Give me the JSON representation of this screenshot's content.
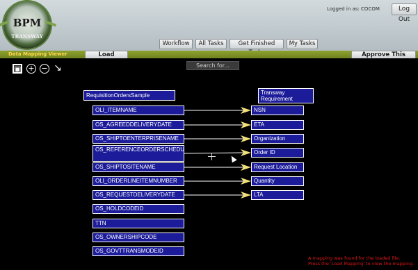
{
  "header": {
    "logo_text": "BPM",
    "logo_ring_text": "TRANSWAY",
    "logged_in": "Logged in as: COCOM",
    "logout_label": "Log Out",
    "tabs": [
      "Workflow",
      "All Tasks",
      "Get Finished Tasks",
      "My Tasks"
    ]
  },
  "toolbar": {
    "viewer_label": "Data Mapping Viewer",
    "load_label": "Load Mapping",
    "approve_label": "Approve This Mapping"
  },
  "canvas": {
    "search_label": "Search for...",
    "tools": [
      "fit-icon",
      "zoom-in-icon",
      "zoom-out-icon",
      "expand-icon"
    ],
    "source_title": "RequisitionOrdersSample",
    "target_title": "Transway Requirement",
    "source_fields": [
      "OLI_ITEMNAME",
      "OS_AGREEDDELIVERYDATE",
      "OS_SHIPTOENTERPRISENAME",
      "OS_REFERENCEORDERSCHEDULENUM",
      "OS_SHIPTOSITENAME",
      "OLI_ORDERLINEITEMNUMBER",
      "OS_REQUESTDELIVERYDATE",
      "OS_HOLDCODEID",
      "TTN",
      "OS_OWNERSHIPCODE",
      "OS_GOVTTRANSMODEID"
    ],
    "target_fields": [
      "NSN",
      "ETA",
      "Organization",
      "Order ID",
      "Request Location",
      "Quantity",
      "LTA"
    ],
    "message_line1": "A mapping was found for the loaded file.",
    "message_line2": "Press the 'Load Mapping' to view the mapping."
  },
  "colors": {
    "node_fill": "#1c1c9a",
    "arrow_head": "#f2e07a",
    "accent_bar": "#7f9326",
    "message": "#e01818"
  }
}
